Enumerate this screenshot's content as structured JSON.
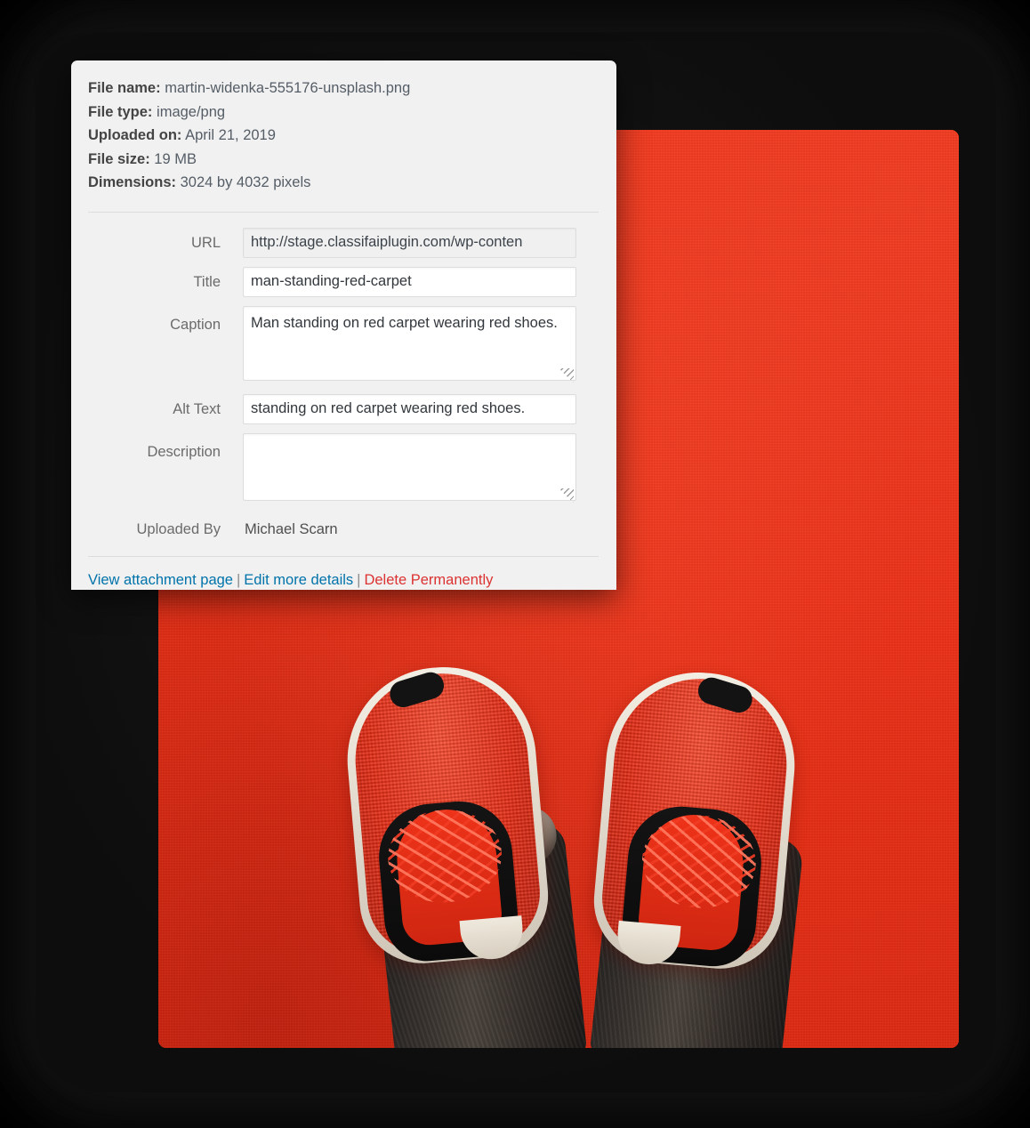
{
  "panel": {
    "metadata": [
      {
        "key": "File name:",
        "value": "martin-widenka-555176-unsplash.png"
      },
      {
        "key": "File type:",
        "value": "image/png"
      },
      {
        "key": "Uploaded on:",
        "value": "April 21, 2019"
      },
      {
        "key": "File size:",
        "value": "19 MB"
      },
      {
        "key": "Dimensions:",
        "value": "3024 by 4032 pixels"
      }
    ],
    "fields": {
      "url": {
        "label": "URL",
        "value": "http://stage.classifaiplugin.com/wp-conten",
        "placeholder": ""
      },
      "title": {
        "label": "Title",
        "value": "man-standing-red-carpet",
        "placeholder": ""
      },
      "caption": {
        "label": "Caption",
        "value": "Man standing on red carpet wearing red shoes.",
        "placeholder": ""
      },
      "alt_text": {
        "label": "Alt Text",
        "value": "standing on red carpet wearing red shoes.",
        "placeholder": ""
      },
      "description": {
        "label": "Description",
        "value": "",
        "placeholder": ""
      },
      "uploaded_by": {
        "label": "Uploaded By",
        "value": "Michael Scarn"
      }
    },
    "actions": {
      "view_attachment": "View attachment page",
      "separator_1": "|",
      "edit_more_details": "Edit more details",
      "separator_2": "|",
      "delete_permanently": "Delete Permanently"
    }
  },
  "media": {
    "alt": "Man standing on red carpet wearing red shoes."
  },
  "colors": {
    "link": "#0073aa",
    "danger": "#dc3232",
    "panel_bg": "#f1f1f1",
    "carpet_red": "#f2371d",
    "backdrop": "#000000"
  }
}
